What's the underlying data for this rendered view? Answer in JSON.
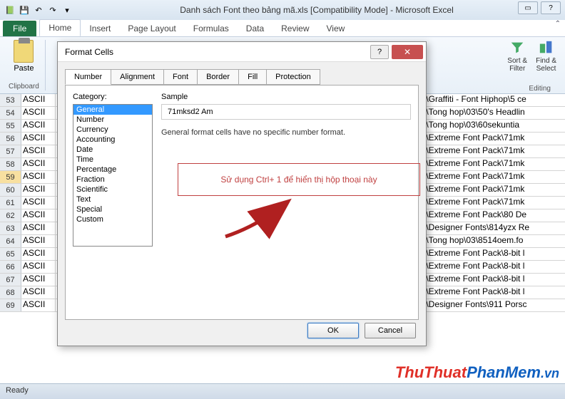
{
  "app": {
    "title": "Danh sách Font theo bảng mã.xls  [Compatibility Mode] - Microsoft Excel"
  },
  "ribbon": {
    "file": "File",
    "tabs": [
      "Home",
      "Insert",
      "Page Layout",
      "Formulas",
      "Data",
      "Review",
      "View"
    ],
    "active_tab": "Home",
    "paste_label": "Paste",
    "groups": {
      "clipboard": "Clipboard",
      "editing": "Editing"
    },
    "right_items": {
      "sort_filter": "Sort &\nFilter",
      "find_select": "Find &\nSelect"
    }
  },
  "dialog": {
    "title": "Format Cells",
    "tabs": [
      "Number",
      "Alignment",
      "Font",
      "Border",
      "Fill",
      "Protection"
    ],
    "active_tab": "Number",
    "category_label": "Category:",
    "categories": [
      "General",
      "Number",
      "Currency",
      "Accounting",
      "Date",
      "Time",
      "Percentage",
      "Fraction",
      "Scientific",
      "Text",
      "Special",
      "Custom"
    ],
    "selected_category": "General",
    "sample_label": "Sample",
    "sample_value": "71mksd2 Am",
    "description": "General format cells have no specific number format.",
    "note": "Sử dụng Ctrl+ 1 để hiển thị hộp thoại này",
    "ok": "OK",
    "cancel": "Cancel"
  },
  "sheet": {
    "rows": [
      {
        "num": 53,
        "a": "ASCII",
        "right": "I\\Graffiti - Font Hiphop\\5 ce"
      },
      {
        "num": 54,
        "a": "ASCII",
        "right": "I\\Tong hop\\03\\50's Headlin"
      },
      {
        "num": 55,
        "a": "ASCII",
        "right": "I\\Tong hop\\03\\60sekuntia"
      },
      {
        "num": 56,
        "a": "ASCII",
        "right": "I\\Extreme Font Pack\\71mk"
      },
      {
        "num": 57,
        "a": "ASCII",
        "right": "I\\Extreme Font Pack\\71mk"
      },
      {
        "num": 58,
        "a": "ASCII",
        "right": "I\\Extreme Font Pack\\71mk"
      },
      {
        "num": 59,
        "a": "ASCII",
        "right": "I\\Extreme Font Pack\\71mk",
        "sel": true
      },
      {
        "num": 60,
        "a": "ASCII",
        "right": "I\\Extreme Font Pack\\71mk"
      },
      {
        "num": 61,
        "a": "ASCII",
        "right": "I\\Extreme Font Pack\\71mk"
      },
      {
        "num": 62,
        "a": "ASCII",
        "right": "I\\Extreme Font Pack\\80 De"
      },
      {
        "num": 63,
        "a": "ASCII",
        "right": "I\\Designer Fonts\\814yzx Re"
      },
      {
        "num": 64,
        "a": "ASCII",
        "right": "I\\Tong hop\\03\\8514oem.fo"
      },
      {
        "num": 65,
        "a": "ASCII",
        "right": "I\\Extreme Font Pack\\8-bit l"
      },
      {
        "num": 66,
        "a": "ASCII",
        "right": "I\\Extreme Font Pack\\8-bit l"
      },
      {
        "num": 67,
        "a": "ASCII",
        "right": "I\\Extreme Font Pack\\8-bit l"
      },
      {
        "num": 68,
        "a": "ASCII",
        "right": "I\\Extreme Font Pack\\8-bit l"
      },
      {
        "num": 69,
        "a": "ASCII",
        "right": "I\\Designer Fonts\\911 Porsc"
      }
    ]
  },
  "statusbar": {
    "ready": "Ready"
  },
  "watermark": {
    "t1": "ThuThuat",
    "t2": "PhanMem",
    "t3": ".vn"
  }
}
